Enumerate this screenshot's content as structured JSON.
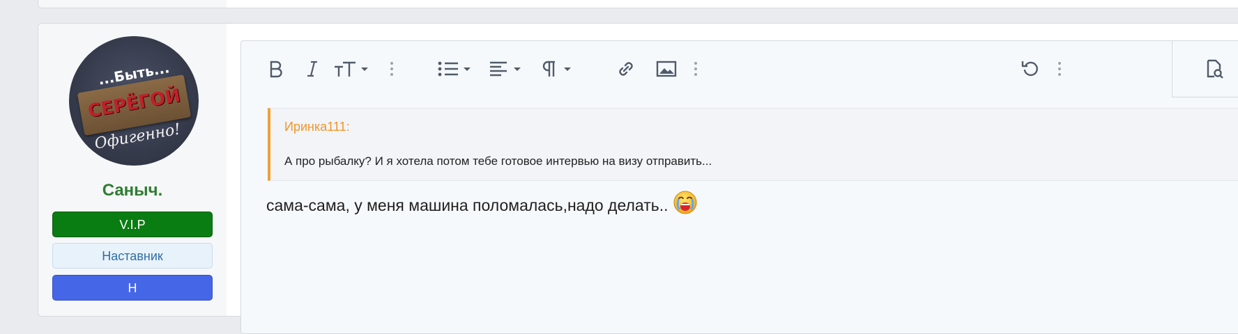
{
  "sidebar": {
    "avatar": {
      "line1": "...Быть...",
      "plank": "СЕРЁГОЙ",
      "line3": "Офигенно!"
    },
    "username": "Саныч.",
    "badges": [
      {
        "label": "V.I.P",
        "color": "#0a7d12"
      },
      {
        "label": "Наставник",
        "color": "#e8f2fb"
      },
      {
        "label": "Н",
        "color": "#4666e8"
      }
    ]
  },
  "toolbar": {
    "items": [
      {
        "name": "bold",
        "icon": "bold-icon"
      },
      {
        "name": "italic",
        "icon": "italic-icon"
      },
      {
        "name": "font-size",
        "icon": "font-size-icon"
      },
      {
        "name": "more-text",
        "icon": "vertical-dots-icon"
      },
      {
        "name": "list",
        "icon": "list-icon"
      },
      {
        "name": "align",
        "icon": "align-icon"
      },
      {
        "name": "paragraph",
        "icon": "paragraph-icon"
      },
      {
        "name": "link",
        "icon": "link-icon"
      },
      {
        "name": "image",
        "icon": "image-icon"
      },
      {
        "name": "more-insert",
        "icon": "vertical-dots-icon"
      },
      {
        "name": "undo",
        "icon": "undo-icon"
      },
      {
        "name": "more-misc",
        "icon": "vertical-dots-icon"
      },
      {
        "name": "preview",
        "icon": "preview-icon"
      }
    ]
  },
  "quote": {
    "author": "Иринка111:",
    "text": "А про рыбалку? И  я хотела потом тебе готовое интервью на визу отправить..."
  },
  "message": {
    "text": "сама-сама, у меня машина поломалась,надо делать..",
    "emoji": "crying-face-icon"
  },
  "colors": {
    "accent_quote": "#f0a035",
    "username": "#2e7d32"
  }
}
